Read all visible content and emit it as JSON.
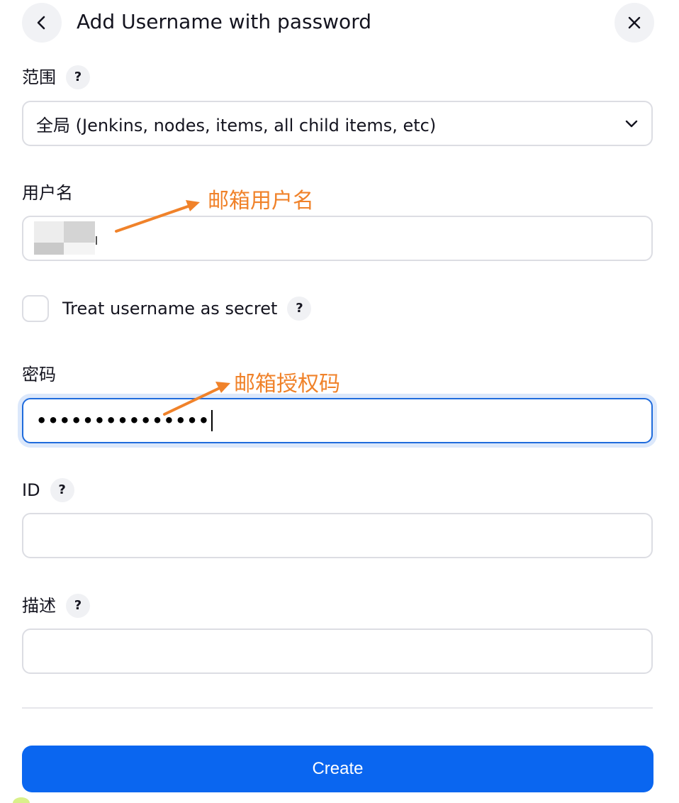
{
  "header": {
    "title": "Add Username with password",
    "back_icon": "chevron-left-icon",
    "close_icon": "close-icon"
  },
  "scope": {
    "label": "范围",
    "help": "?",
    "selected": "全局 (Jenkins, nodes, items, all child items, etc)",
    "dropdown_icon": "chevron-down-icon"
  },
  "username": {
    "label": "用户名",
    "value": ""
  },
  "treat_secret": {
    "label": "Treat username as secret",
    "help": "?",
    "checked": false
  },
  "password": {
    "label": "密码",
    "value_masked": "•••••••••••••••"
  },
  "id_field": {
    "label": "ID",
    "help": "?",
    "value": ""
  },
  "description": {
    "label": "描述",
    "help": "?",
    "value": ""
  },
  "actions": {
    "create_label": "Create"
  },
  "annotations": {
    "username_note": "邮箱用户名",
    "password_note": "邮箱授权码",
    "color": "#f0822a"
  },
  "colors": {
    "primary": "#0a66f0",
    "focus_border": "#1f6bdc"
  }
}
